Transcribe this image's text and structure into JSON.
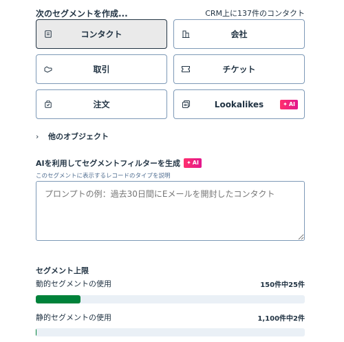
{
  "header": {
    "title": "次のセグメントを作成...",
    "contact_count": "CRM上に137件のコンタクト"
  },
  "tiles": [
    {
      "label": "コンタクト",
      "icon": "contact-card-icon",
      "selected": true
    },
    {
      "label": "会社",
      "icon": "building-icon",
      "selected": false
    },
    {
      "label": "取引",
      "icon": "deal-handshake-icon",
      "selected": false
    },
    {
      "label": "チケット",
      "icon": "ticket-icon",
      "selected": false
    },
    {
      "label": "注文",
      "icon": "order-bag-icon",
      "selected": false
    },
    {
      "label": "Lookalikes",
      "icon": "lookalike-icon",
      "selected": false,
      "badge": "AI"
    }
  ],
  "other_objects": {
    "label": "他のオブジェクト"
  },
  "ai_section": {
    "title": "AIを利用してセグメントフィルターを生成",
    "badge": "AI",
    "description": "このセグメントに表示するレコードのタイプを説明",
    "placeholder": "プロンプトの例：過去30日間にEメールを開封したコンタクト"
  },
  "limits": {
    "title": "セグメント上限",
    "dynamic": {
      "label": "動的セグメントの使用",
      "value": "150件中25件",
      "fraction": 0.1667
    },
    "static": {
      "label": "静的セグメントの使用",
      "value": "1,100件中2件",
      "fraction": 0.0018
    }
  },
  "colors": {
    "primary_text": "#213343",
    "border": "#7c98b6",
    "ai_badge": "#ff2f6d",
    "usage_fill": "#00823a",
    "bar_track": "#eaf0f6"
  }
}
